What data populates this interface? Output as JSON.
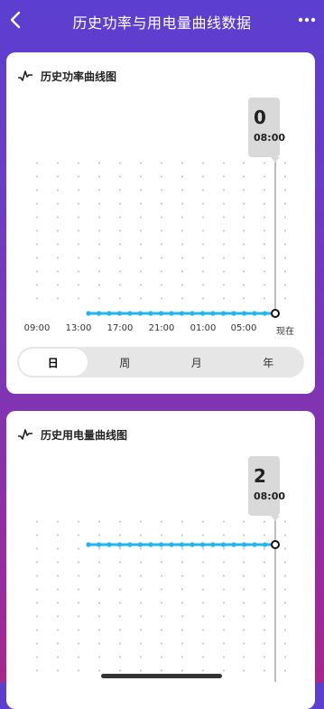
{
  "header": {
    "title": "历史功率与用电量曲线数据"
  },
  "power_card": {
    "title": "历史功率曲线图",
    "tooltip": {
      "value": "0",
      "time": "08:00"
    },
    "x_labels": [
      "09:00",
      "13:00",
      "17:00",
      "21:00",
      "01:00",
      "05:00",
      "现在"
    ],
    "tabs": [
      "日",
      "周",
      "月",
      "年"
    ],
    "active_tab": "日"
  },
  "energy_card": {
    "title": "历史用电量曲线图",
    "tooltip": {
      "value": "2",
      "time": "08:00"
    }
  },
  "colors": {
    "line": "#1fb6ef",
    "accent_purple": "#5b3fd0"
  },
  "chart_data": [
    {
      "type": "line",
      "title": "历史功率曲线图",
      "categories": [
        "09:00",
        "13:00",
        "17:00",
        "21:00",
        "01:00",
        "05:00",
        "现在"
      ],
      "x_label_points": 18,
      "values": [
        0,
        0,
        0,
        0,
        0,
        0,
        0,
        0,
        0,
        0,
        0,
        0,
        0,
        0,
        0,
        0,
        0,
        0,
        0
      ],
      "grid": "dotted-vertical"
    },
    {
      "type": "line",
      "title": "历史用电量曲线图",
      "values": [
        2,
        2,
        2,
        2,
        2,
        2,
        2,
        2,
        2,
        2,
        2,
        2,
        2,
        2,
        2,
        2,
        2,
        2,
        2
      ],
      "grid": "dotted-vertical"
    }
  ]
}
